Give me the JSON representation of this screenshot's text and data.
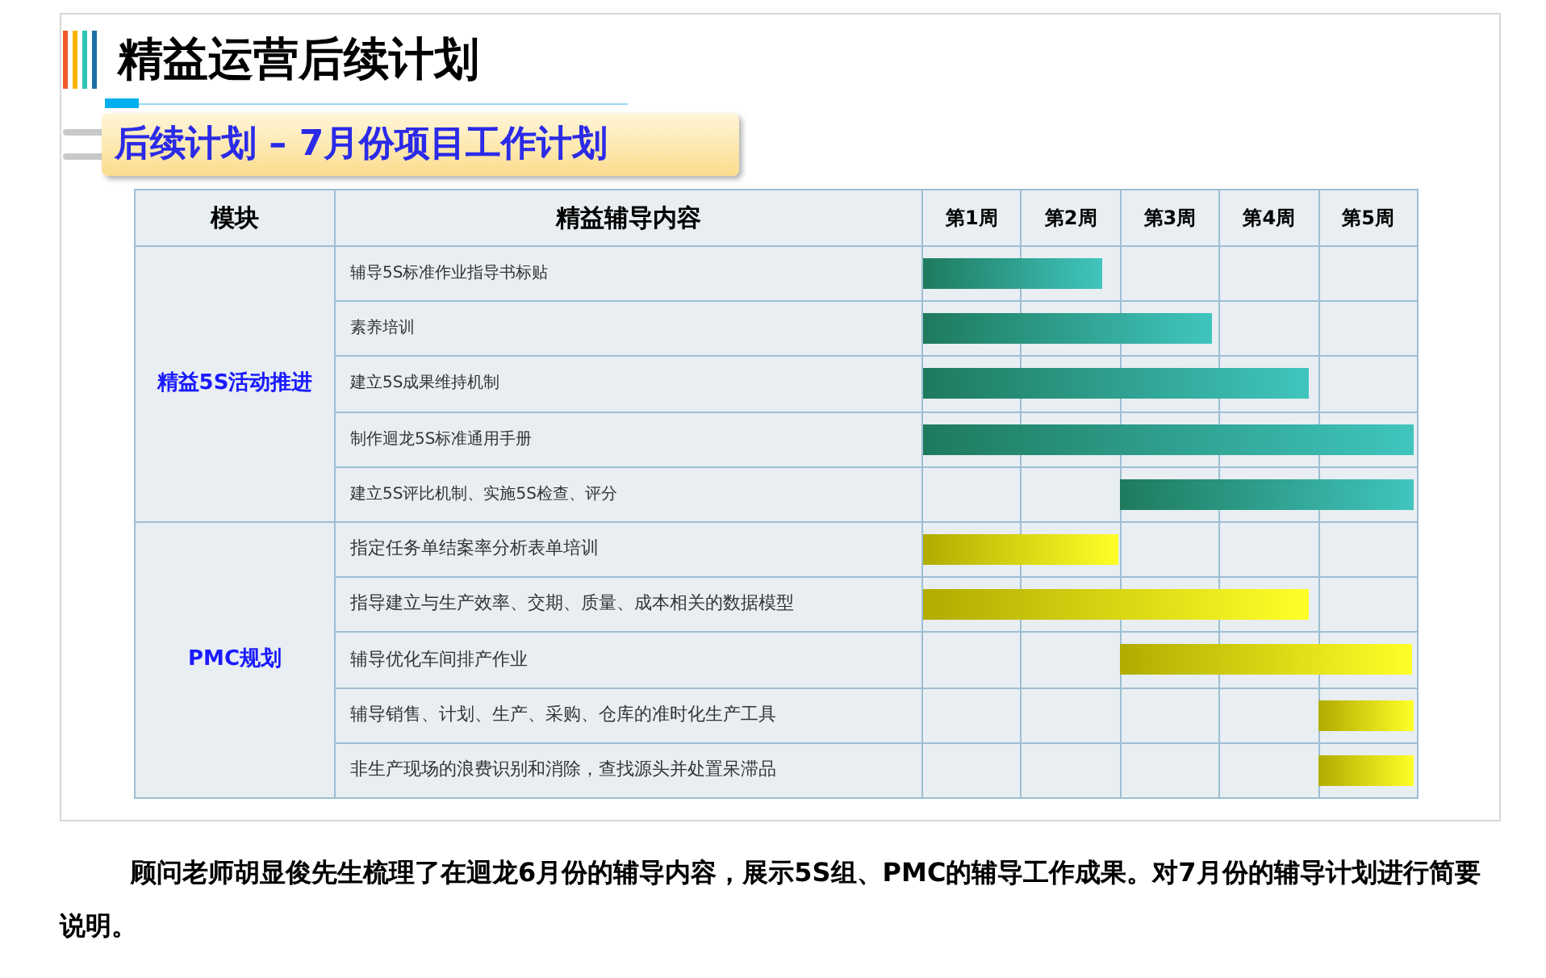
{
  "title": "精益运营后续计划",
  "subtitle": "后续计划 – 7月份项目工作计划",
  "table": {
    "columns": [
      "模块",
      "精益辅导内容",
      "第1周",
      "第2周",
      "第3周",
      "第4周",
      "第5周"
    ],
    "groups": [
      {
        "name": "精益5S活动推进",
        "color": "#1e7a5e",
        "tasks": [
          {
            "text": "辅导5S标准作业指导书标贴",
            "kind": "early",
            "bar": {
              "level": 0.364
            }
          },
          {
            "text": "素养培训",
            "kind": "early",
            "bar": {
              "level": 0.586
            }
          },
          {
            "text": "建立5S成果维持机制",
            "kind": "early",
            "bar": {
              "level": 0.78
            }
          },
          {
            "text": "制作迴龙5S标准通用手册",
            "kind": "early",
            "bar": {
              "level": 0.992
            }
          },
          {
            "text": "建立5S评比机制、实施5S检查、评分",
            "kind": "mid",
            "bar": {
              "level": 0.592
            }
          }
        ]
      },
      {
        "name": "PMC规划",
        "color": "#b0ac00",
        "tasks": [
          {
            "text": "指定任务单结案率分析表单培训",
            "kind": "early",
            "bar": {
              "level": 0.396
            }
          },
          {
            "text": "指导建立与生产效率、交期、质量、成本相关的数据模型",
            "kind": "early",
            "bar": {
              "level": 0.78
            }
          },
          {
            "text": "辅导优化车间排产作业",
            "kind": "mid",
            "bar": {
              "level": 0.59
            }
          },
          {
            "text": "辅导销售、计划、生产、采购、仓库的准时化生产工具",
            "kind": "late",
            "bar": {
              "level": 0.192
            }
          },
          {
            "text": "非生产现场的浪费识别和消除，查找源头并处置呆滞品",
            "kind": "late",
            "bar": {
              "level": 0.192
            }
          }
        ]
      }
    ]
  },
  "paragraph": "顾问老师胡显俊先生梳理了在迴龙6月份的辅导内容，展示5S组、PMC的辅导工作成果。对7月份的辅导计划进行简要说明。"
}
